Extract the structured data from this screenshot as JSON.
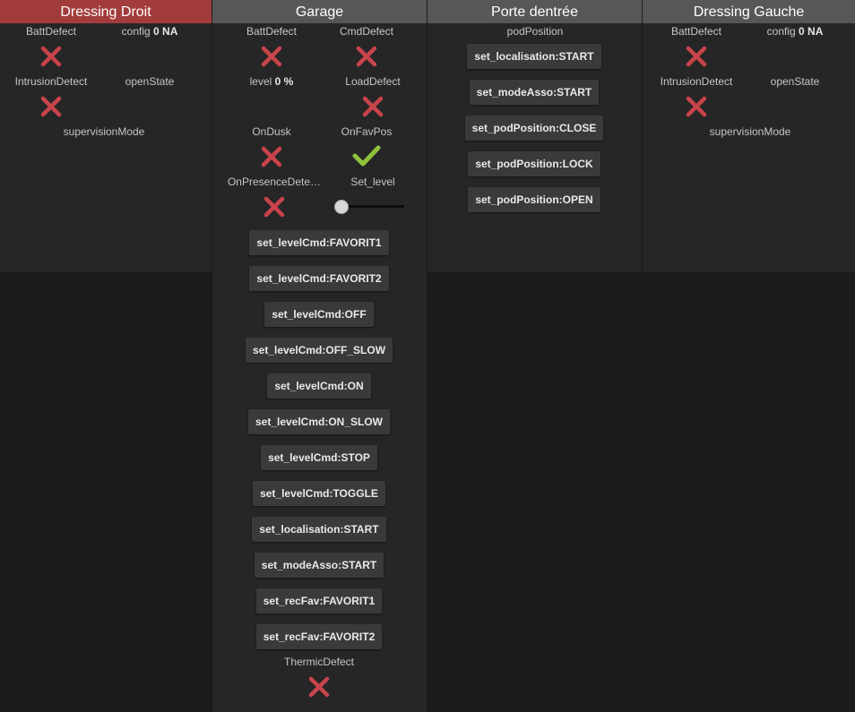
{
  "colors": {
    "cross": "#c9434b",
    "check": "#8fc23a"
  },
  "dressing_droit": {
    "title": "Dressing Droit",
    "batt_defect": "BattDefect",
    "config_label": "config",
    "config_value": "0 NA",
    "intrusion_detect": "IntrusionDetect",
    "open_state": "openState",
    "supervision_mode": "supervisionMode"
  },
  "garage": {
    "title": "Garage",
    "batt_defect": "BattDefect",
    "cmd_defect": "CmdDefect",
    "level_label": "level",
    "level_value": "0 %",
    "load_defect": "LoadDefect",
    "on_dusk": "OnDusk",
    "on_fav_pos": "OnFavPos",
    "on_presence": "OnPresenceDete…",
    "set_level": "Set_level",
    "set_level_value": 0,
    "commands": [
      "set_levelCmd:FAVORIT1",
      "set_levelCmd:FAVORIT2",
      "set_levelCmd:OFF",
      "set_levelCmd:OFF_SLOW",
      "set_levelCmd:ON",
      "set_levelCmd:ON_SLOW",
      "set_levelCmd:STOP",
      "set_levelCmd:TOGGLE",
      "set_localisation:START",
      "set_modeAsso:START",
      "set_recFav:FAVORIT1",
      "set_recFav:FAVORIT2"
    ],
    "thermic_defect": "ThermicDefect"
  },
  "porte": {
    "title": "Porte dentrée",
    "pod_position": "podPosition",
    "commands": [
      "set_localisation:START",
      "set_modeAsso:START",
      "set_podPosition:CLOSE",
      "set_podPosition:LOCK",
      "set_podPosition:OPEN"
    ]
  },
  "dressing_gauche": {
    "title": "Dressing Gauche",
    "batt_defect": "BattDefect",
    "config_label": "config",
    "config_value": "0 NA",
    "intrusion_detect": "IntrusionDetect",
    "open_state": "openState",
    "supervision_mode": "supervisionMode"
  }
}
